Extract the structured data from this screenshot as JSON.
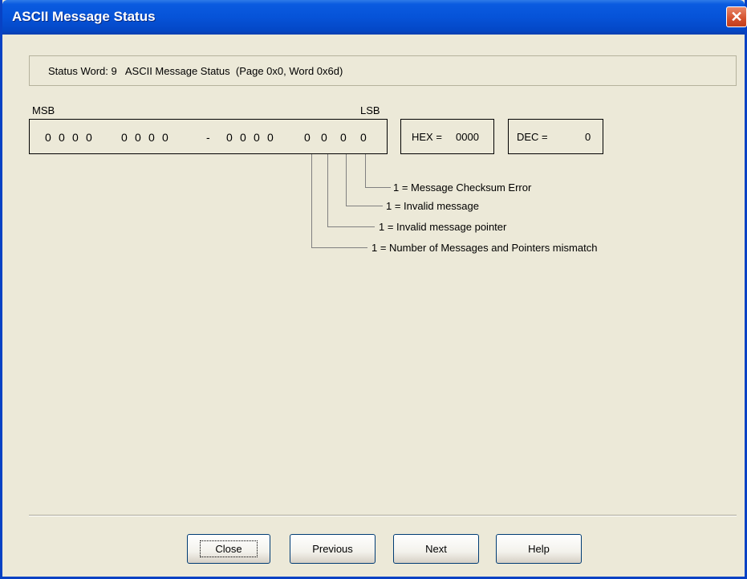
{
  "window": {
    "title": "ASCII Message Status",
    "close_glyph": "✕"
  },
  "status": {
    "text": "Status Word: 9   ASCII Message Status  (Page 0x0, Word 0x6d)"
  },
  "bits": {
    "msb_label": "MSB",
    "lsb_label": "LSB",
    "values": [
      "0",
      "0",
      "0",
      "0",
      "0",
      "0",
      "0",
      "0",
      "-",
      "0",
      "0",
      "0",
      "0",
      "0",
      "0",
      "0",
      "0"
    ]
  },
  "hex": {
    "label": "HEX =",
    "value": "0000"
  },
  "dec": {
    "label": "DEC =",
    "value": "0"
  },
  "descriptions": [
    "1 = Message Checksum Error",
    "1 = Invalid message",
    "1 = Invalid message pointer",
    "1 = Number of Messages and Pointers mismatch"
  ],
  "buttons": {
    "close": "Close",
    "previous": "Previous",
    "next": "Next",
    "help": "Help"
  }
}
